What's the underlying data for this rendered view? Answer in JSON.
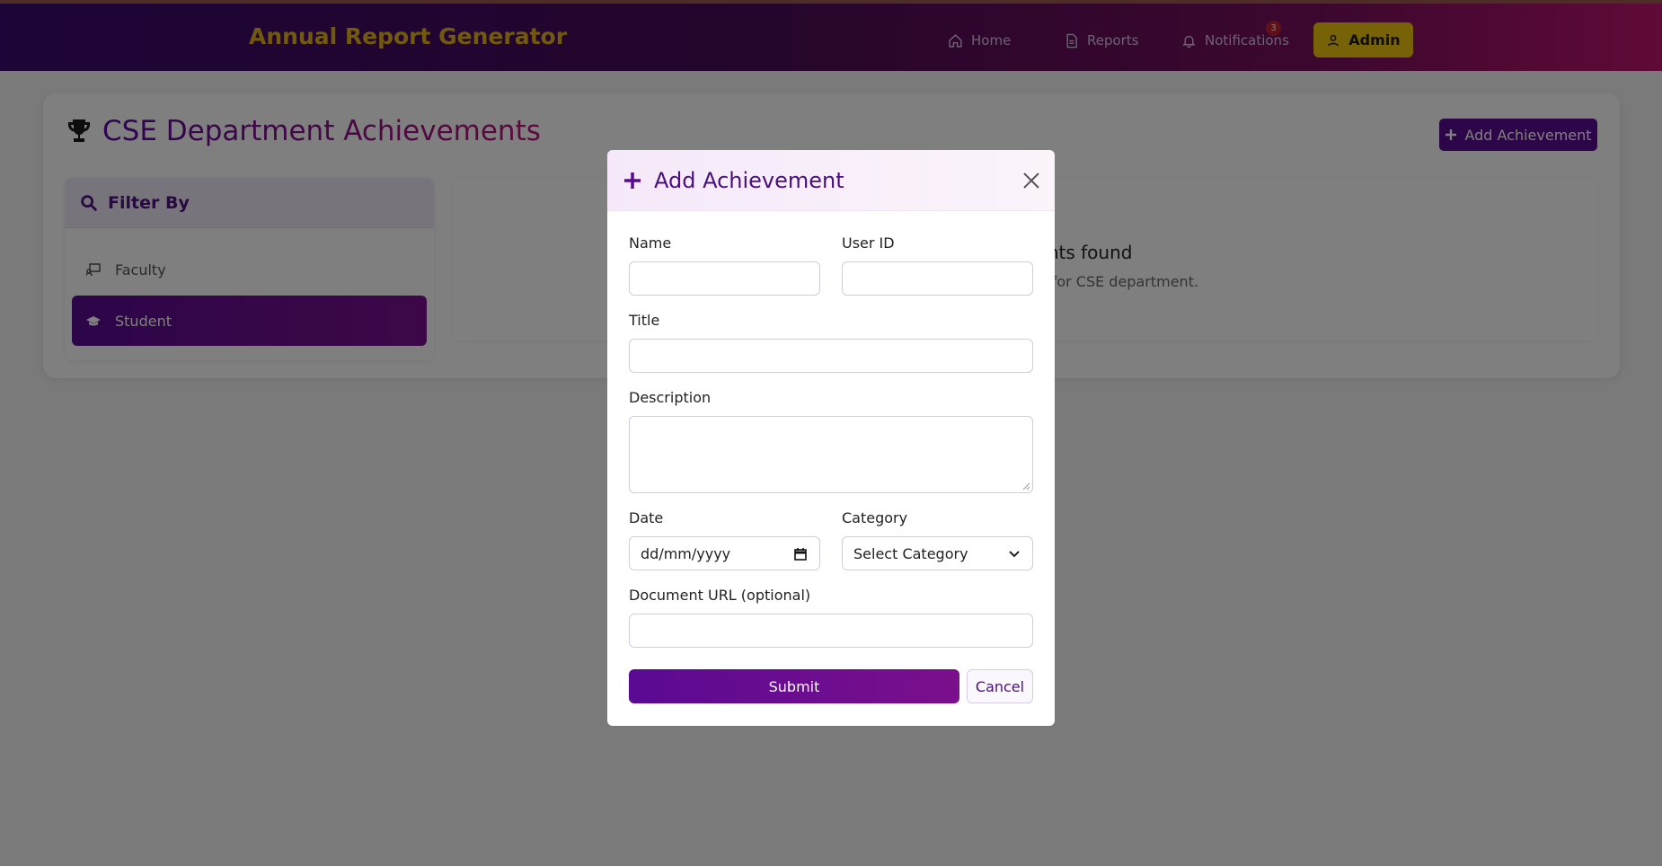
{
  "navbar": {
    "brand": "Annual Report Generator",
    "home_label": "Home",
    "reports_label": "Reports",
    "notifications_label": "Notifications",
    "notifications_count": "3",
    "admin_label": "Admin"
  },
  "page": {
    "title": "CSE Department Achievements",
    "add_button_label": "Add Achievement"
  },
  "filter": {
    "heading": "Filter By",
    "items": [
      {
        "label": "Faculty",
        "icon": "chalkboard-teacher-icon"
      },
      {
        "label": "Student",
        "icon": "graduation-cap-icon",
        "selected": true
      }
    ]
  },
  "results": {
    "empty_title": "No achievements found",
    "empty_subtitle": "No achievements available for CSE department."
  },
  "modal": {
    "title": "Add Achievement",
    "name_label": "Name",
    "name_value": "",
    "user_id_label": "User ID",
    "user_id_value": "",
    "title_label": "Title",
    "title_value": "",
    "description_label": "Description",
    "description_value": "",
    "date_label": "Date",
    "date_value": "dd/mm/yyyy",
    "category_label": "Category",
    "category_value": "Select Category",
    "document_url_label": "Document URL (optional)",
    "document_url_value": "",
    "submit_label": "Submit",
    "cancel_label": "Cancel"
  },
  "colors": {
    "brand": "#e4b321",
    "primary": "#5b0a93",
    "admin_button": "#f1c40f",
    "badge": "#b8242e"
  }
}
